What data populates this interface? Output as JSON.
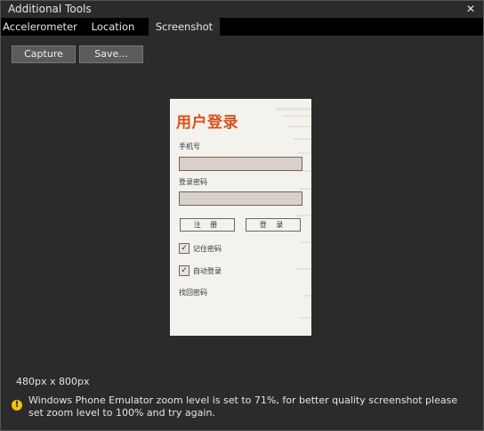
{
  "window": {
    "title": "Additional Tools",
    "close_glyph": "✕"
  },
  "tabs": [
    {
      "label": "Accelerometer",
      "active": false
    },
    {
      "label": "Location",
      "active": false
    },
    {
      "label": "Screenshot",
      "active": true
    }
  ],
  "toolbar": {
    "capture_label": "Capture",
    "save_label": "Save..."
  },
  "phone": {
    "app_title": "用户登录",
    "phone_label": "手机号",
    "phone_value": "",
    "password_label": "登录密码",
    "password_value": "",
    "register_label": "注 册",
    "login_label": "登 录",
    "remember_password": {
      "label": "记住密码",
      "checked": true
    },
    "auto_login": {
      "label": "自动登录",
      "checked": true
    },
    "find_password_label": "找回密码"
  },
  "status": {
    "resolution": "480px x 800px",
    "warning_icon": "warning-icon",
    "warning_message": "Windows Phone Emulator zoom level is set to 71%, for better quality screenshot please set zoom level to 100% and try again."
  },
  "colors": {
    "background": "#2b2b2b",
    "tab_strip": "#000000",
    "accent_title": "#d7501e",
    "warning": "#f2c20f"
  }
}
